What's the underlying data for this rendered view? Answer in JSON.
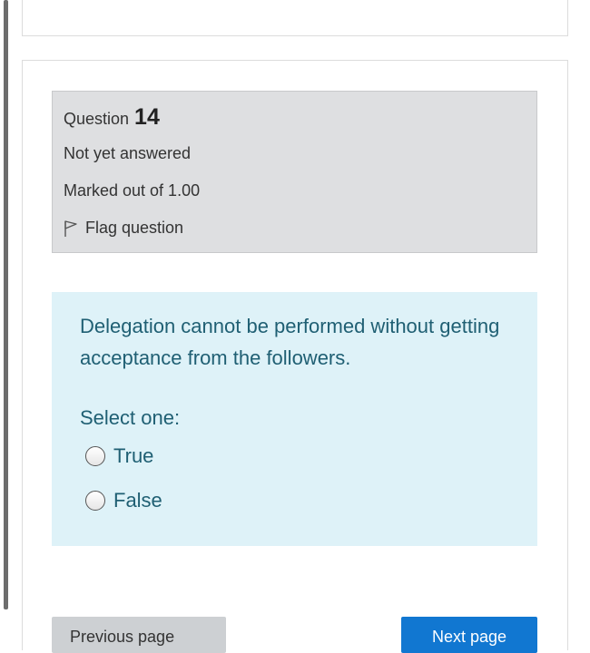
{
  "question": {
    "label": "Question",
    "number": "14",
    "state": "Not yet answered",
    "grade": "Marked out of 1.00",
    "flag_label": "Flag question"
  },
  "content": {
    "text": "Delegation cannot be performed without getting acceptance from the followers.",
    "prompt": "Select one:",
    "options": [
      {
        "label": "True",
        "selected": false
      },
      {
        "label": "False",
        "selected": false
      }
    ]
  },
  "navigation": {
    "previous_label": "Previous page",
    "next_label": "Next page"
  },
  "colors": {
    "info_bg": "#dedfe1",
    "content_bg": "#def2f8",
    "content_text": "#1f5f73",
    "next_button": "#1177d1"
  }
}
